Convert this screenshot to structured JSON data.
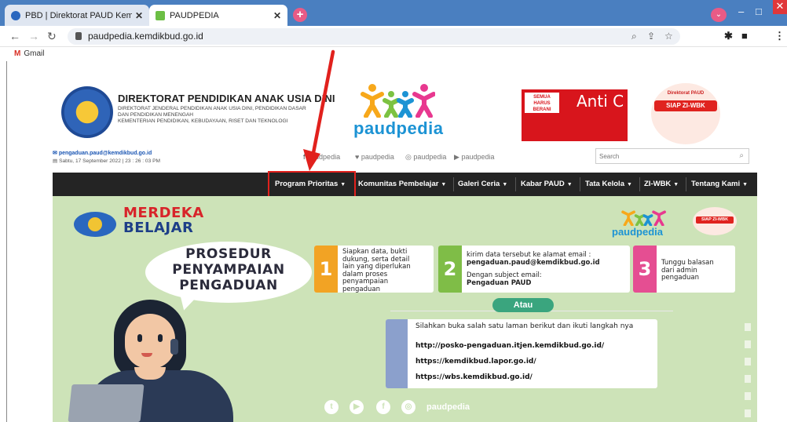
{
  "browser": {
    "tabs": [
      {
        "title": "PBD | Direktorat PAUD Kemendi",
        "active": false
      },
      {
        "title": "PAUDPEDIA",
        "active": true
      }
    ],
    "new_tab": "+",
    "url": "paudpedia.kemdikbud.go.id",
    "bookmark_gmail": "Gmail"
  },
  "header": {
    "org_title": "DIREKTORAT PENDIDIKAN ANAK USIA DINI",
    "org_sub_lines": [
      "DIREKTORAT JENDERAL PENDIDIKAN ANAK USIA DINI, PENDIDIKAN DASAR",
      "DAN PENDIDIKAN MENENGAH",
      "KEMENTERIAN PENDIDIKAN, KEBUDAYAAN, RISET DAN TEKNOLOGI"
    ],
    "logo_text": "paudpedia",
    "banner_title": "Anti C",
    "banner_inner": "SEMUA HARUS BERANI",
    "badge_top": "Direktorat PAUD",
    "badge_band": "SIAP ZI-WBK",
    "contact_email": "pengaduan.paud@kemdikbud.go.id",
    "contact_date": "Sabtu, 17 September 2022 | 23 : 26 : 03 PM",
    "social": [
      "paudpedia",
      "paudpedia",
      "paudpedia",
      "paudpedia"
    ],
    "search_placeholder": "Search"
  },
  "nav": {
    "items": [
      {
        "label": "Program Prioritas"
      },
      {
        "label": "Komunitas Pembelajar"
      },
      {
        "label": "Galeri Ceria"
      },
      {
        "label": "Kabar PAUD"
      },
      {
        "label": "Tata Kelola"
      },
      {
        "label": "ZI-WBK"
      },
      {
        "label": "Tentang Kami"
      }
    ]
  },
  "infographic": {
    "merdeka": "MERDEKA",
    "belajar": "BELAJAR",
    "logo_small": "paudpedia",
    "zi_small": "SIAP ZI-WBK",
    "headline": [
      "PROSEDUR",
      "PENYAMPAIAN",
      "PENGADUAN"
    ],
    "steps": [
      {
        "num": "1",
        "lines": [
          "Siapkan data, bukti",
          "dukung, serta detail",
          "lain yang diperlukan",
          "dalam proses",
          "penyampaian",
          "pengaduan"
        ]
      },
      {
        "num": "2",
        "lines": [
          "kirim data tersebut ke alamat email :",
          "pengaduan.paud@kemdikbud.go.id",
          "",
          "Dengan subject email:",
          "Pengaduan PAUD"
        ]
      },
      {
        "num": "3",
        "lines": [
          "Tunggu balasan",
          "dari admin",
          "pengaduan"
        ]
      }
    ],
    "atau": "Atau",
    "links_intro": "Silahkan buka salah satu laman berikut dan ikuti langkah nya",
    "links": [
      "http://posko-pengaduan.itjen.kemdikbud.go.id/",
      "https://kemdikbud.lapor.go.id/",
      "https://wbs.kemdikbud.go.id/"
    ],
    "footer_handle": "paudpedia"
  },
  "colors": {
    "tabstrip": "#4a7fc0",
    "nav_bg": "#242424",
    "highlight": "#e1211d",
    "infographic_bg": "#cde3b8"
  }
}
